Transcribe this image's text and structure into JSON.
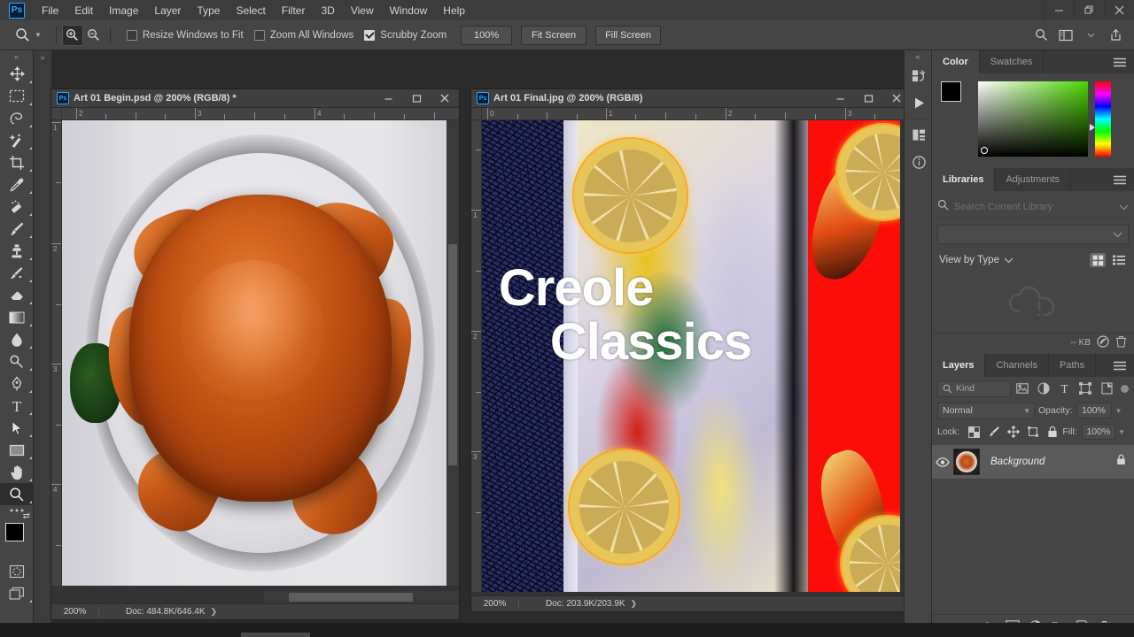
{
  "app": {
    "name": "Adobe Photoshop",
    "logo_text": "Ps"
  },
  "window_controls": {
    "minimize": "minimize-icon",
    "restore": "restore-icon",
    "close": "close-icon"
  },
  "menubar": {
    "items": [
      {
        "label": "File"
      },
      {
        "label": "Edit"
      },
      {
        "label": "Image"
      },
      {
        "label": "Layer"
      },
      {
        "label": "Type"
      },
      {
        "label": "Select"
      },
      {
        "label": "Filter"
      },
      {
        "label": "3D"
      },
      {
        "label": "View"
      },
      {
        "label": "Window"
      },
      {
        "label": "Help"
      }
    ]
  },
  "options_bar": {
    "active_tool_icon": "zoom-tool-icon",
    "zoom_in_icon": "zoom-in-icon",
    "zoom_out_icon": "zoom-out-icon",
    "checkboxes": [
      {
        "label": "Resize Windows to Fit",
        "checked": false
      },
      {
        "label": "Zoom All Windows",
        "checked": false
      },
      {
        "label": "Scrubby Zoom",
        "checked": true
      }
    ],
    "zoom_value": "100%",
    "buttons": [
      {
        "label": "Fit Screen"
      },
      {
        "label": "Fill Screen"
      }
    ],
    "right_icons": [
      {
        "name": "search-icon"
      },
      {
        "name": "workspace-arrange-icon"
      },
      {
        "name": "chevron-down-icon"
      },
      {
        "name": "share-icon"
      }
    ]
  },
  "toolbar": {
    "tools": [
      {
        "name": "move-tool",
        "icon": "move-icon",
        "selected": false
      },
      {
        "name": "rectangular-marquee-tool",
        "icon": "marquee-icon",
        "selected": false
      },
      {
        "name": "lasso-tool",
        "icon": "lasso-icon",
        "selected": false
      },
      {
        "name": "magic-wand-tool",
        "icon": "magic-wand-icon",
        "selected": false
      },
      {
        "name": "crop-tool",
        "icon": "crop-icon",
        "selected": false
      },
      {
        "name": "eyedropper-tool",
        "icon": "eyedropper-icon",
        "selected": false
      },
      {
        "name": "spot-healing-brush-tool",
        "icon": "healing-brush-icon",
        "selected": false
      },
      {
        "name": "brush-tool",
        "icon": "brush-icon",
        "selected": false
      },
      {
        "name": "clone-stamp-tool",
        "icon": "clone-stamp-icon",
        "selected": false
      },
      {
        "name": "history-brush-tool",
        "icon": "history-brush-icon",
        "selected": false
      },
      {
        "name": "eraser-tool",
        "icon": "eraser-icon",
        "selected": false
      },
      {
        "name": "gradient-tool",
        "icon": "gradient-icon",
        "selected": false
      },
      {
        "name": "blur-tool",
        "icon": "blur-drop-icon",
        "selected": false
      },
      {
        "name": "dodge-tool",
        "icon": "dodge-icon",
        "selected": false
      },
      {
        "name": "pen-tool",
        "icon": "pen-icon",
        "selected": false
      },
      {
        "name": "type-tool",
        "icon": "type-t-icon",
        "selected": false
      },
      {
        "name": "path-selection-tool",
        "icon": "path-arrow-icon",
        "selected": false
      },
      {
        "name": "rectangle-tool",
        "icon": "rectangle-icon",
        "selected": false
      },
      {
        "name": "hand-tool",
        "icon": "hand-icon",
        "selected": false
      },
      {
        "name": "zoom-tool",
        "icon": "magnifier-icon",
        "selected": true
      }
    ],
    "edit_toolbar_icon": "ellipsis-icon",
    "foreground_color": "#000000",
    "background_color": "#ffffff",
    "quick_mask_icon": "quick-mask-icon",
    "screen_mode_icon": "screen-mode-icon"
  },
  "dock_strip": {
    "icons": [
      {
        "name": "history-icon"
      },
      {
        "name": "actions-play-icon"
      },
      {
        "name": "properties-icon"
      },
      {
        "name": "info-icon"
      }
    ]
  },
  "documents": [
    {
      "id": "begin",
      "title": "Art 01 Begin.psd @ 200% (RGB/8) *",
      "zoom": "200%",
      "doc_size": "Doc: 484.8K/646.4K",
      "ruler_h_labels": [
        "2",
        "3",
        "4"
      ],
      "ruler_v_labels": [
        "1",
        "2",
        "3",
        "4"
      ],
      "artwork": "cooked-crab-on-white-plate-photo"
    },
    {
      "id": "final",
      "title": "Art 01 Final.jpg @ 200% (RGB/8)",
      "zoom": "200%",
      "doc_size": "Doc: 203.9K/203.9K",
      "ruler_h_labels": [
        "0",
        "1",
        "2",
        "3"
      ],
      "ruler_v_labels": [
        "1",
        "2",
        "3"
      ],
      "artwork": "creole-classics-poster",
      "art_text_line1": "Creole",
      "art_text_line2": "Classics"
    }
  ],
  "color_panel": {
    "tabs": [
      {
        "label": "Color",
        "active": true
      },
      {
        "label": "Swatches",
        "active": false
      }
    ],
    "menu_icon": "panel-menu-icon",
    "foreground_color": "#000000",
    "background_color": "#ffffff",
    "picker_hue_color": "#4cd600"
  },
  "libraries_panel": {
    "tabs": [
      {
        "label": "Libraries",
        "active": true
      },
      {
        "label": "Adjustments",
        "active": false
      }
    ],
    "menu_icon": "panel-menu-icon",
    "search_placeholder": "Search Current Library",
    "search_icon": "search-icon",
    "view_label": "View by Type",
    "view_chevron_icon": "chevron-down-icon",
    "grid_view_icon": "grid-view-icon",
    "list_view_icon": "list-view-icon",
    "empty_icon": "creative-cloud-icon",
    "size_label": "-- KB",
    "cloud_icon": "creative-cloud-sync-icon",
    "delete_icon": "trash-icon"
  },
  "layers_panel": {
    "tabs": [
      {
        "label": "Layers",
        "active": true
      },
      {
        "label": "Channels",
        "active": false
      },
      {
        "label": "Paths",
        "active": false
      }
    ],
    "menu_icon": "panel-menu-icon",
    "filter_label": "Kind",
    "filter_search_icon": "search-icon",
    "filter_icons": [
      {
        "name": "filter-pixel-icon"
      },
      {
        "name": "filter-adjustment-icon"
      },
      {
        "name": "filter-type-icon"
      },
      {
        "name": "filter-shape-icon"
      },
      {
        "name": "filter-smart-object-icon"
      }
    ],
    "filter_toggle_icon": "filter-toggle-icon",
    "blend_mode": "Normal",
    "opacity_label": "Opacity:",
    "opacity_value": "100%",
    "lock_label": "Lock:",
    "lock_icons": [
      {
        "name": "lock-transparent-pixels-icon"
      },
      {
        "name": "lock-image-pixels-icon"
      },
      {
        "name": "lock-position-icon"
      },
      {
        "name": "lock-artboard-icon"
      },
      {
        "name": "lock-all-icon"
      }
    ],
    "fill_label": "Fill:",
    "fill_value": "100%",
    "layers": [
      {
        "name": "Background",
        "visible": true,
        "locked": true,
        "visibility_icon": "eye-icon",
        "lock_icon": "lock-icon",
        "thumbnail": "crab-photo-thumbnail"
      }
    ],
    "footer_icons": [
      {
        "name": "link-layers-icon"
      },
      {
        "name": "layer-styles-fx-icon"
      },
      {
        "name": "add-layer-mask-icon"
      },
      {
        "name": "new-adjustment-layer-icon"
      },
      {
        "name": "new-group-icon"
      },
      {
        "name": "new-layer-icon"
      },
      {
        "name": "delete-layer-icon"
      }
    ]
  }
}
